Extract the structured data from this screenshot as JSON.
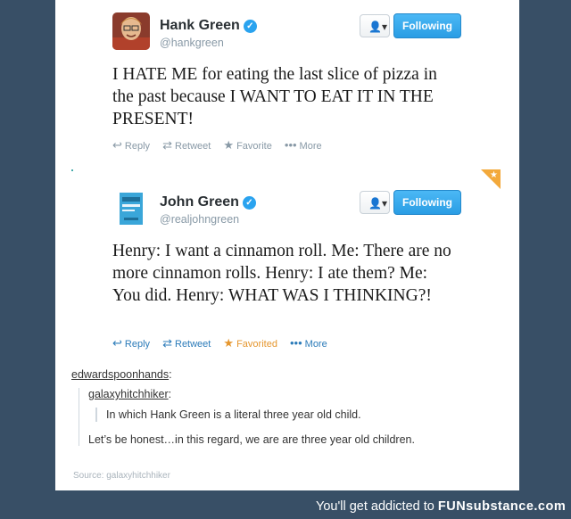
{
  "tweets": [
    {
      "name": "Hank Green",
      "handle": "@hankgreen",
      "follow_label": "Following",
      "text": "I HATE ME for eating the last slice of pizza in the past because I WANT TO EAT IT IN THE PRESENT!",
      "actions": {
        "reply": "Reply",
        "retweet": "Retweet",
        "favorite": "Favorite",
        "more": "More"
      }
    },
    {
      "name": "John Green",
      "handle": "@realjohngreen",
      "follow_label": "Following",
      "text": "Henry: I want a cinnamon roll. Me: There are no more cinnamon rolls. Henry: I ate them? Me: You did. Henry: WHAT WAS I THINKING?!",
      "actions": {
        "reply": "Reply",
        "retweet": "Retweet",
        "favorite": "Favorited",
        "more": "More"
      }
    }
  ],
  "reblog": {
    "user1": "edwardspoonhands",
    "user2": "galaxyhitchhiker",
    "quote": "In which Hank Green is a literal three year old child.",
    "comment": "Let’s be honest…in this regard, we are are three year old children.",
    "source": "Source: galaxyhitchhiker"
  },
  "footer": {
    "text": "You'll get addicted to",
    "brand": "FUNsubstance.com"
  },
  "colors": {
    "background": "#384f66",
    "twitter_blue": "#2aa3ef",
    "favorited": "#e5962e"
  }
}
